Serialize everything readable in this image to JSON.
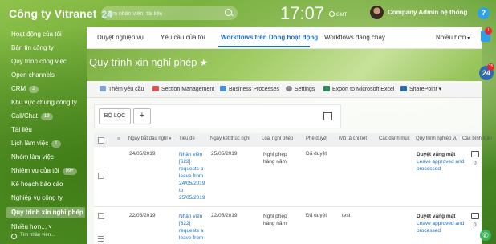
{
  "header": {
    "company": "Công ty Vitranet",
    "logo_mark": "24",
    "search_placeholder": "Tìm nhân viên, tài liệu",
    "time": "17:07",
    "timezone_label": "GMT",
    "user_name": "Company Admin hệ thống",
    "help": "?"
  },
  "sidebar": {
    "items": [
      {
        "label": "Hoạt động của tôi"
      },
      {
        "label": "Bản tin công ty"
      },
      {
        "label": "Quy trình công việc"
      },
      {
        "label": "Open channels"
      },
      {
        "label": "CRM",
        "count": "2"
      },
      {
        "label": "Khu vực chung công ty"
      },
      {
        "label": "Call/Chat",
        "count": "19"
      },
      {
        "label": "Tài liệu"
      },
      {
        "label": "Lịch làm việc",
        "count": "1"
      },
      {
        "label": "Nhóm làm việc"
      },
      {
        "label": "Nhiệm vụ của tôi",
        "count": "99+"
      },
      {
        "label": "Kế hoạch báo cáo"
      },
      {
        "label": "Nghiệp vụ công ty"
      },
      {
        "label": "Quy trình xin nghỉ phép"
      },
      {
        "label": "Nhiều hơn... ˅"
      }
    ],
    "bottom_search": "Tìm nhân viên..."
  },
  "tabs": [
    {
      "label": "Duyệt nghiệp vụ"
    },
    {
      "label": "Yêu cầu của tôi"
    },
    {
      "label": "Workflows trên Dòng hoạt động"
    },
    {
      "label": "Workflows đang chạy"
    },
    {
      "label": "Nhiều hơn"
    }
  ],
  "page": {
    "title": "Quy trình xin nghỉ phép",
    "star": "★"
  },
  "toolbar": {
    "items": [
      {
        "label": "Thêm yêu cầu"
      },
      {
        "label": "Section Management"
      },
      {
        "label": "Business Processes"
      },
      {
        "label": "Settings"
      },
      {
        "label": "Export to Microsoft Excel"
      },
      {
        "label": "SharePoint"
      }
    ]
  },
  "filter": {
    "filter_button": "BỘ LỌC",
    "add_button": "+"
  },
  "table": {
    "columns": [
      "Ngày bắt đầu nghỉ",
      "Tiêu đề",
      "Ngày kết thúc nghỉ",
      "Loại nghỉ phép",
      "Phê duyệt",
      "Mô tả chi tiết",
      "Các danh mục",
      "Quy trình nghiệp vụ",
      "Các bình luận"
    ],
    "rows": [
      {
        "start": "24/05/2019",
        "title": "Nhân viên [622] requests a leave from 24/05/2019 to 25/05/2019",
        "end": "25/05/2019",
        "type": "Nghỉ phép hàng năm",
        "approval": "Đã duyệt",
        "desc": "",
        "category": "",
        "wf_title": "Duyệt vắng mặt",
        "wf_status": "Leave approved and processed",
        "comments": "0"
      },
      {
        "start": "22/05/2019",
        "title": "Nhân viên [622] requests a leave from",
        "end": "22/05/2019",
        "type": "Nghỉ phép hàng năm",
        "approval": "Đã duyệt",
        "desc": "test",
        "category": "",
        "wf_title": "Duyệt vắng mặt",
        "wf_status": "Leave approved and processed",
        "comments": "0"
      }
    ]
  },
  "rail": {
    "bell_badge": "1",
    "b24_badge": "15",
    "b24": "24"
  },
  "colors": {
    "accent": "#1a6fc0",
    "help": "#2ea0e6",
    "phone": "#3cb35a"
  }
}
